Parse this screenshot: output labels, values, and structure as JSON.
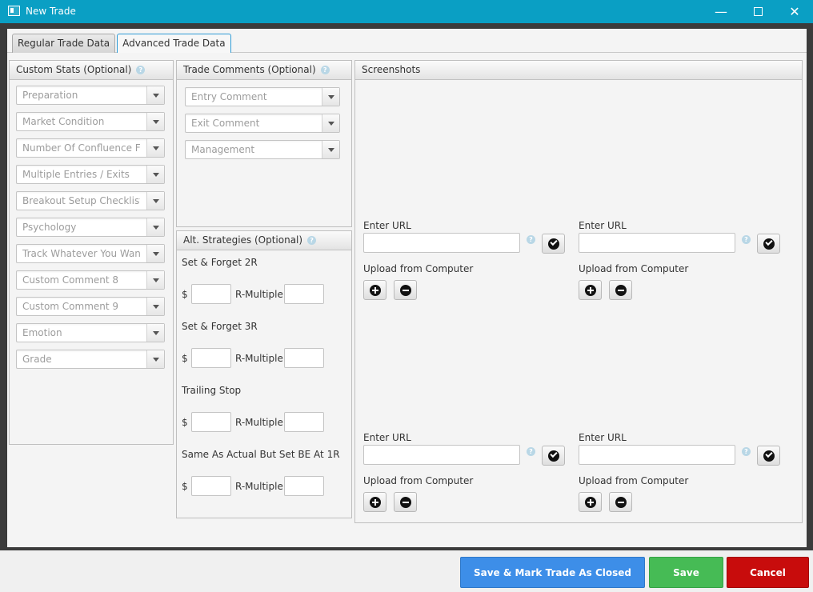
{
  "window": {
    "title": "New Trade",
    "minimize_glyph": "—",
    "close_glyph": "✕"
  },
  "tabs": [
    {
      "label": "Regular Trade Data",
      "active": false
    },
    {
      "label": "Advanced Trade Data",
      "active": true
    }
  ],
  "custom_stats": {
    "title": "Custom Stats (Optional)",
    "help": "?",
    "combos": [
      "Preparation",
      "Market Condition",
      "Number Of Confluence Fact",
      "Multiple Entries / Exits",
      "Breakout Setup Checklist",
      "Psychology",
      "Track Whatever You Want",
      "Custom Comment 8",
      "Custom Comment 9",
      "Emotion",
      "Grade"
    ]
  },
  "trade_comments": {
    "title": "Trade Comments (Optional)",
    "help": "?",
    "combos": [
      "Entry Comment",
      "Exit Comment",
      "Management"
    ]
  },
  "alt_strategies": {
    "title": "Alt. Strategies (Optional)",
    "help": "?",
    "dollar": "$",
    "r_multiple": "R-Multiple",
    "items": [
      "Set & Forget 2R",
      "Set & Forget 3R",
      "Trailing Stop",
      "Same As Actual But Set BE At 1R"
    ]
  },
  "screenshots": {
    "title": "Screenshots",
    "enter_url": "Enter URL",
    "upload": "Upload from Computer",
    "help": "?"
  },
  "footer": {
    "save_close": "Save & Mark Trade As Closed",
    "save": "Save",
    "cancel": "Cancel"
  },
  "colors": {
    "titlebar": "#0a9fc4",
    "save_close": "#3d8ee8",
    "save": "#46bb55",
    "cancel": "#c80c0c"
  }
}
